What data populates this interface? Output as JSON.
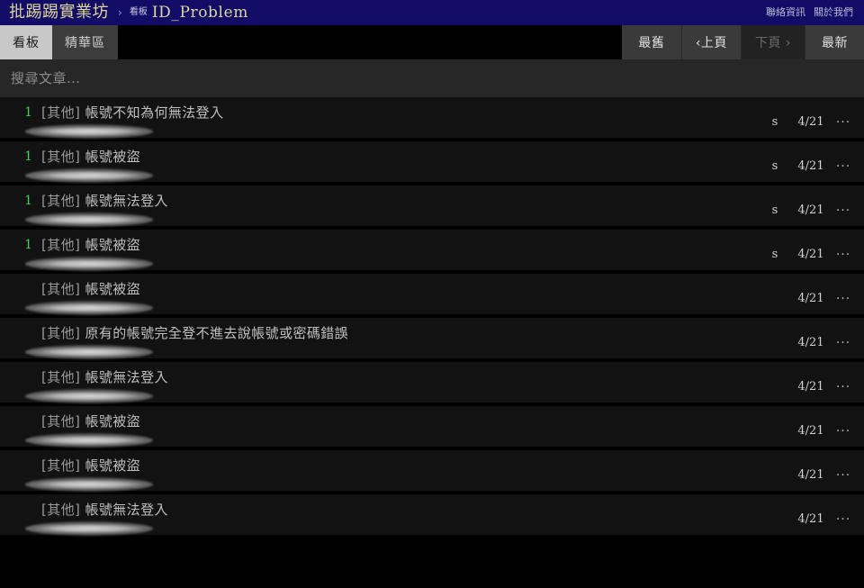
{
  "header": {
    "site_title": "批踢踢實業坊",
    "breadcrumb_separator": "›",
    "breadcrumb_kind": "看板",
    "breadcrumb_board": "ID_Problem",
    "links": [
      {
        "label": "聯絡資訊"
      },
      {
        "label": "關於我們"
      }
    ],
    "bg_color": "#130c66",
    "title_color": "#dcd79b"
  },
  "tabs": [
    {
      "label": "看板",
      "active": true
    },
    {
      "label": "精華區",
      "active": false
    }
  ],
  "pager": [
    {
      "label": "最舊",
      "disabled": false
    },
    {
      "label": "‹上頁",
      "disabled": false
    },
    {
      "label": "下頁 ›",
      "disabled": true
    },
    {
      "label": "最新",
      "disabled": false
    }
  ],
  "search": {
    "placeholder": "搜尋文章…",
    "value": ""
  },
  "list": {
    "more_glyph": "···",
    "count_color": "#3fd156",
    "rows": [
      {
        "count": "1",
        "tag": "[其他]",
        "title": "帳號不知為何無法登入",
        "author": "s",
        "date": "4/21"
      },
      {
        "count": "1",
        "tag": "[其他]",
        "title": "帳號被盜",
        "author": "s",
        "date": "4/21"
      },
      {
        "count": "1",
        "tag": "[其他]",
        "title": "帳號無法登入",
        "author": "s",
        "date": "4/21"
      },
      {
        "count": "1",
        "tag": "[其他]",
        "title": "帳號被盜",
        "author": "s",
        "date": "4/21"
      },
      {
        "count": "",
        "tag": "[其他]",
        "title": "帳號被盜",
        "author": "",
        "date": "4/21"
      },
      {
        "count": "",
        "tag": "[其他]",
        "title": "原有的帳號完全登不進去說帳號或密碼錯誤",
        "author": "",
        "date": "4/21"
      },
      {
        "count": "",
        "tag": "[其他]",
        "title": "帳號無法登入",
        "author": "",
        "date": "4/21"
      },
      {
        "count": "",
        "tag": "[其他]",
        "title": "帳號被盜",
        "author": "",
        "date": "4/21"
      },
      {
        "count": "",
        "tag": "[其他]",
        "title": "帳號被盜",
        "author": "",
        "date": "4/21"
      },
      {
        "count": "",
        "tag": "[其他]",
        "title": "帳號無法登入",
        "author": "",
        "date": "4/21"
      }
    ]
  }
}
